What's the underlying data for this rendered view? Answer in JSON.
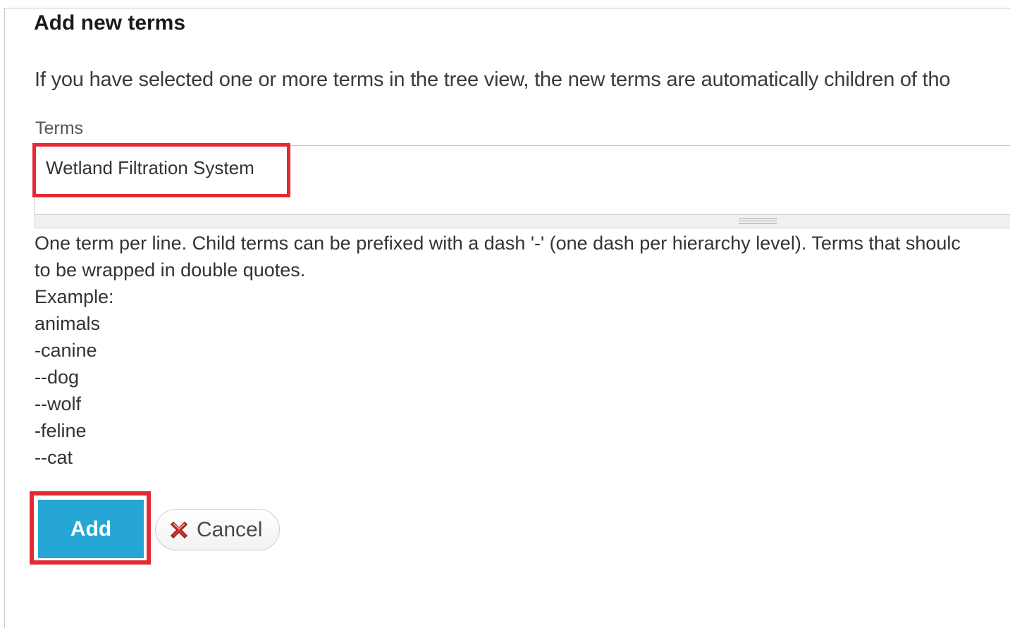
{
  "fieldset": {
    "legend": "Add new terms",
    "intro": "If you have selected one or more terms in the tree view, the new terms are automatically children of tho"
  },
  "terms_field": {
    "label": "Terms",
    "value": "Wetland Filtration System"
  },
  "description": {
    "lines": [
      "One term per line. Child terms can be prefixed with a dash '-' (one dash per hierarchy level). Terms that shoulc",
      "to be wrapped in double quotes.",
      "Example:",
      "animals",
      "-canine",
      "--dog",
      "--wolf",
      "-feline",
      "--cat"
    ]
  },
  "buttons": {
    "add_label": "Add",
    "cancel_label": "Cancel"
  },
  "icons": {
    "cancel": "close-x-icon"
  },
  "colors": {
    "add_button": "#25a6d5",
    "highlight": "#e32a34",
    "cancel_icon": "#d9342b"
  }
}
